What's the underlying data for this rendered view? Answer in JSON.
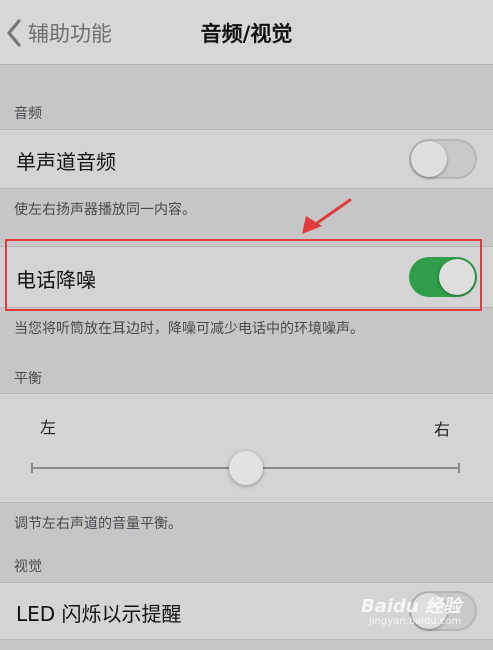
{
  "nav": {
    "back_label": "辅助功能",
    "title": "音频/视觉"
  },
  "audio": {
    "header": "音频",
    "mono_label": "单声道音频",
    "mono_on": false,
    "mono_footer": "使左右扬声器播放同一内容。",
    "noise_label": "电话降噪",
    "noise_on": true,
    "noise_footer": "当您将听筒放在耳边时，降噪可减少电话中的环境噪声。"
  },
  "balance": {
    "header": "平衡",
    "left_label": "左",
    "right_label": "右",
    "value": 0.5,
    "footer": "调节左右声道的音量平衡。"
  },
  "visual": {
    "header": "视觉",
    "led_label": "LED 闪烁以示提醒",
    "led_on": false
  },
  "colors": {
    "switch_on": "#2f9d49",
    "highlight": "#e03c3c"
  },
  "watermark": {
    "brand": "Baidu 经验",
    "url": "jingyan.baidu.com"
  }
}
